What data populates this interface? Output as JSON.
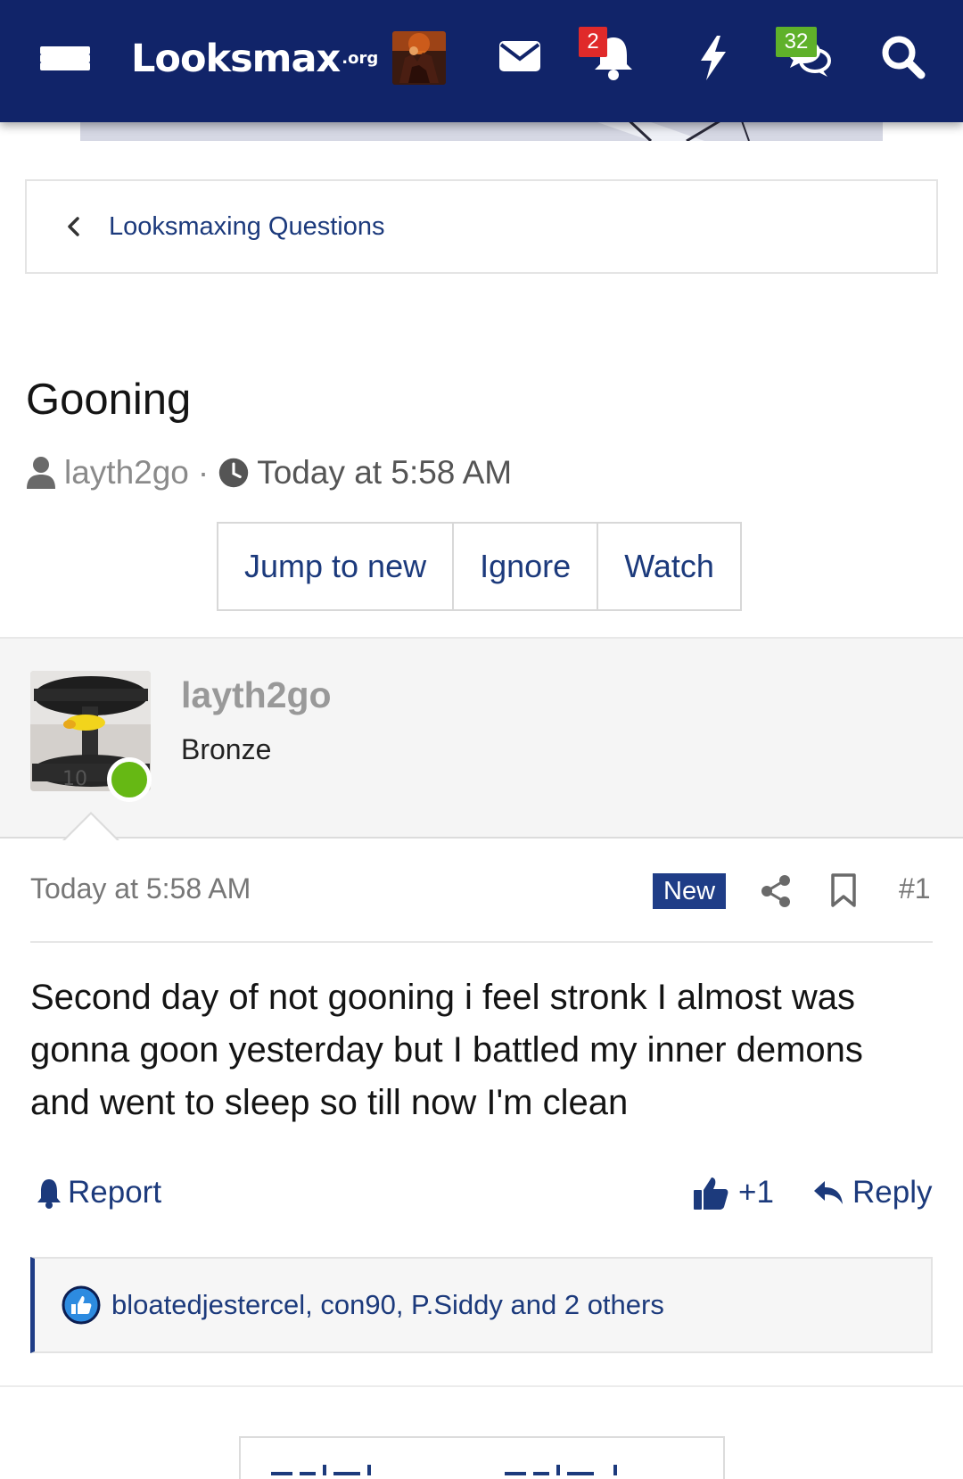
{
  "nav": {
    "logo": "Looksmax",
    "logo_tld": ".org",
    "alerts_count": "2",
    "conversations_count": "32",
    "icons": [
      "menu-icon",
      "avatar",
      "envelope-icon",
      "bell-icon",
      "bolt-icon",
      "chat-icon",
      "search-icon"
    ],
    "colors": {
      "bar": "#112469",
      "alerts_badge": "#e02a2a",
      "convos_badge": "#5fb12a"
    }
  },
  "breadcrumb": {
    "label": "Looksmaxing Questions"
  },
  "thread": {
    "title": "Gooning",
    "author": "layth2go",
    "separator": "·",
    "time": "Today at 5:58 AM",
    "buttons": {
      "jump": "Jump to new",
      "ignore": "Ignore",
      "watch": "Watch"
    }
  },
  "post": {
    "username": "layth2go",
    "rank": "Bronze",
    "online": true,
    "time": "Today at 5:58 AM",
    "badge": "New",
    "number": "#1",
    "content": "Second day of not gooning i feel stronk I almost was gonna goon yesterday but I battled my inner demons and went to sleep so till now I'm clean",
    "report_label": "Report",
    "like_label": "+1",
    "reply_label": "Reply",
    "reactions_text": "bloatedjestercel, con90, P.Siddy and 2 others",
    "accent_color": "#1f3d87"
  }
}
